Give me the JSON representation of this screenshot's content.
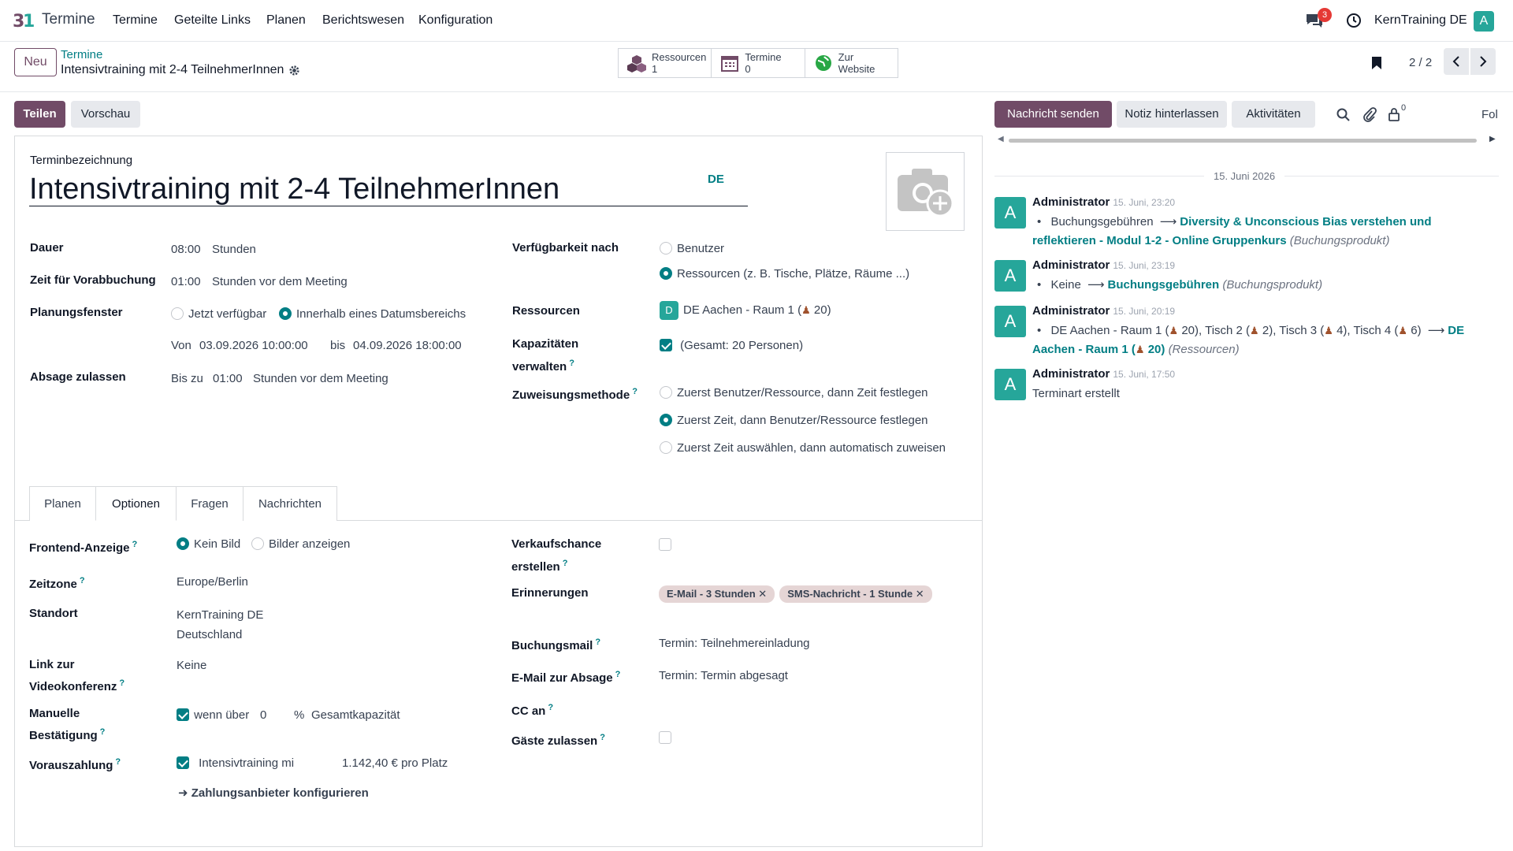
{
  "nav": {
    "app_name": "Termine",
    "menu": [
      "Termine",
      "Geteilte Links",
      "Planen",
      "Berichtswesen",
      "Konfiguration"
    ],
    "chat_badge": "3",
    "company": "KernTraining DE",
    "user_initial": "A"
  },
  "control": {
    "new_label": "Neu",
    "breadcrumb_parent": "Termine",
    "breadcrumb_current": "Intensivtraining mit 2-4 TeilnehmerInnen",
    "smart_buttons": [
      {
        "label": "Ressourcen",
        "value": "1",
        "icon": "cubes-icon"
      },
      {
        "label": "Termine",
        "value": "0",
        "icon": "calendar-icon"
      },
      {
        "label": "Zur",
        "value": "Website",
        "icon": "globe-icon"
      }
    ],
    "pager": "2 / 2"
  },
  "status": {
    "share_label": "Teilen",
    "preview_label": "Vorschau"
  },
  "form": {
    "name_label": "Terminbezeichnung",
    "name_value": "Intensivtraining mit 2-4 TeilnehmerInnen",
    "lang": "DE",
    "duration_label": "Dauer",
    "duration_value": "08:00",
    "duration_unit": "Stunden",
    "prebook_label": "Zeit für Vorabbuchung",
    "prebook_value": "01:00",
    "prebook_unit": "Stunden vor dem Meeting",
    "window_label": "Planungsfenster",
    "window_opt1": "Jetzt verfügbar",
    "window_opt2": "Innerhalb eines Datumsbereichs",
    "from_label": "Von",
    "from_value": "03.09.2026 10:00:00",
    "to_label": "bis",
    "to_value": "04.09.2026 18:00:00",
    "cancel_label": "Absage zulassen",
    "cancel_prefix": "Bis zu",
    "cancel_value": "01:00",
    "cancel_unit": "Stunden vor dem Meeting",
    "avail_label": "Verfügbarkeit nach",
    "avail_opt1": "Benutzer",
    "avail_opt2": "Ressourcen (z. B. Tische, Plätze, Räume ...)",
    "resources_label": "Ressourcen",
    "resource_initial": "D",
    "resource_name": "DE Aachen - Raum 1 (",
    "resource_capacity": "20)",
    "capacity_label_1": "Kapazitäten",
    "capacity_label_2": "verwalten",
    "capacity_value": "(Gesamt: 20 Personen)",
    "assign_label": "Zuweisungsmethode",
    "assign_opt1": "Zuerst Benutzer/Ressource, dann Zeit festlegen",
    "assign_opt2": "Zuerst Zeit, dann Benutzer/Ressource festlegen",
    "assign_opt3": "Zuerst Zeit auswählen, dann automatisch zuweisen"
  },
  "tabs": [
    "Planen",
    "Optionen",
    "Fragen",
    "Nachrichten"
  ],
  "options": {
    "frontend_label": "Frontend-Anzeige",
    "frontend_opt1": "Kein Bild",
    "frontend_opt2": "Bilder anzeigen",
    "tz_label": "Zeitzone",
    "tz_value": "Europe/Berlin",
    "location_label": "Standort",
    "location_line1": "KernTraining DE",
    "location_line2": "Deutschland",
    "video_label_1": "Link zur",
    "video_label_2": "Videokonferenz",
    "video_value": "Keine",
    "manual_label_1": "Manuelle",
    "manual_label_2": "Bestätigung",
    "manual_if": "wenn über",
    "manual_value": "0",
    "manual_unit": "%",
    "manual_suffix": "Gesamtkapazität",
    "prepay_label": "Vorauszahlung",
    "prepay_product": "Intensivtraining mi",
    "prepay_price": "1.142,40 € pro Platz",
    "payment_link": "Zahlungsanbieter konfigurieren",
    "opportunity_label_1": "Verkaufschance",
    "opportunity_label_2": "erstellen",
    "reminders_label": "Erinnerungen",
    "reminders": [
      "E-Mail - 3 Stunden",
      "SMS-Nachricht - 1 Stunde"
    ],
    "booking_mail_label": "Buchungsmail",
    "booking_mail_value": "Termin: Teilnehmereinladung",
    "cancel_mail_label": "E-Mail zur Absage",
    "cancel_mail_value": "Termin: Termin abgesagt",
    "cc_label": "CC an",
    "guests_label": "Gäste zulassen"
  },
  "chatter": {
    "send_label": "Nachricht senden",
    "note_label": "Notiz hinterlassen",
    "activities_label": "Aktivitäten",
    "followers_count": "0",
    "follow_label": "Fol",
    "date_separator": "15. Juni 2026",
    "messages": [
      {
        "author": "Administrator",
        "time": "15. Juni, 23:20"
      },
      {
        "author": "Administrator",
        "time": "15. Juni, 23:19"
      },
      {
        "author": "Administrator",
        "time": "15. Juni, 20:19"
      },
      {
        "author": "Administrator",
        "time": "15. Juni, 17:50"
      }
    ],
    "m1_old": "Buchungsgebühren",
    "m1_new": "Diversity & Unconscious Bias verstehen und reflektieren - Modul 1-2 - Online Gruppenkurs",
    "m1_field": "(Buchungsprodukt)",
    "m2_old": "Keine",
    "m2_new": "Buchungsgebühren",
    "m2_field": "(Buchungsprodukt)",
    "m3_old_a": "DE Aachen - Raum 1 (",
    "m3_old_a2": "20), Tisch 2 (",
    "m3_old_b": "2), Tisch 3 (",
    "m3_old_c": "4), Tisch 4 (",
    "m3_old_d": "6)",
    "m3_new": "DE Aachen - Raum 1 (",
    "m3_new_cap": "20)",
    "m3_field": "(Ressourcen)",
    "m4_text": "Terminart erstellt"
  }
}
